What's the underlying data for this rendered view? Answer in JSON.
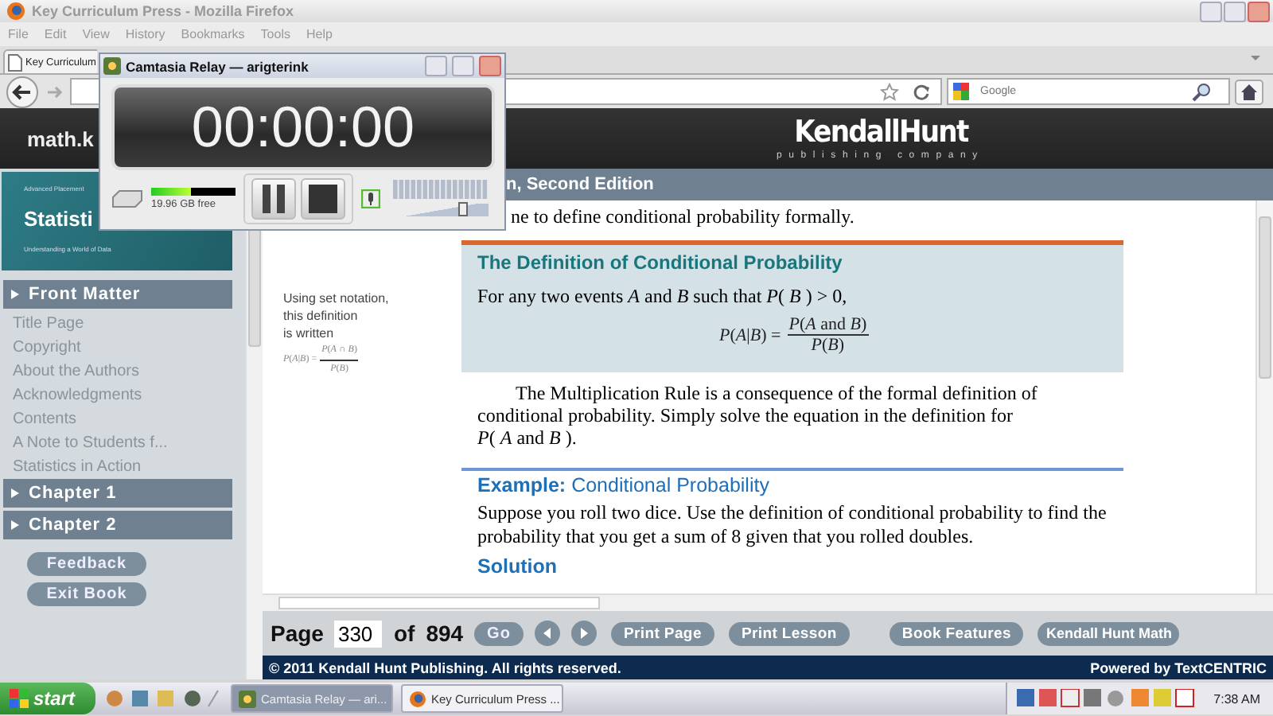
{
  "browser": {
    "title": "Key Curriculum Press - Mozilla Firefox",
    "menu": [
      "File",
      "Edit",
      "View",
      "History",
      "Bookmarks",
      "Tools",
      "Help"
    ],
    "tab": "Key Curriculum",
    "search": {
      "placeholder": "Google"
    }
  },
  "recorder": {
    "title": "Camtasia Relay — arigterink",
    "timer": "00:00:00",
    "disk": {
      "level": 0.47,
      "label": "19.96 GB free"
    },
    "volume": {
      "level": 0.73
    }
  },
  "site": {
    "host": "math.k",
    "logo": "KendallHunt",
    "logo_sub": "publishing company"
  },
  "sidebar": {
    "cover": {
      "kicker": "Advanced Placement",
      "title": "Statisti",
      "subtitle": "Understanding a World of Data"
    },
    "sections": [
      {
        "label": "Front Matter",
        "children": [
          "Title Page",
          "Copyright",
          "About the Authors",
          "Acknowledgments",
          "Contents",
          "A Note to Students f...",
          "Statistics in Action"
        ]
      },
      {
        "label": "Chapter 1"
      },
      {
        "label": "Chapter 2"
      }
    ],
    "buttons": [
      "Feedback",
      "Exit Book"
    ]
  },
  "section_title": "n, Second Edition",
  "content": {
    "intro": "ne to define conditional probability formally.",
    "margin_note": [
      "Using set notation,",
      "this definition",
      "is written"
    ],
    "margin_formula": {
      "left": "*P*(*A*|*B*) =",
      "num": "*P*(*A* ∩ *B*)",
      "den": "*P*(*B*)"
    },
    "definition": {
      "title": "The Definition of Conditional Probability",
      "statement": "For any two events *A* and *B* such that *P*( *B* ) > 0,",
      "formula": {
        "left": "*P*(*A*|*B*) =",
        "num": "*P*(*A* and *B*)",
        "den": "*P*(*B*)"
      }
    },
    "paragraph": "The Multiplication Rule is a consequence of the formal definition of conditional probability. Simply solve the equation in the definition for *P*( *A* and *B* ).",
    "example": {
      "label": "Example:",
      "title": "Conditional Probability",
      "text": "Suppose you roll two dice. Use the definition of conditional probability to find the probability that you get a sum of 8 given that you rolled doubles."
    },
    "solution": "Solution"
  },
  "toolbar": {
    "page_label": "Page",
    "page": "330",
    "of": "of",
    "total": "894",
    "go": "Go",
    "buttons": [
      "Print Page",
      "Print Lesson",
      "Book Features",
      "Kendall Hunt Math"
    ]
  },
  "footer": {
    "copyright": "© 2011 Kendall Hunt Publishing. All rights reserved.",
    "powered": "Powered by TextCENTRIC"
  },
  "taskbar": {
    "start": "start",
    "tasks": [
      {
        "label": "Camtasia Relay — ari...",
        "selected": true
      },
      {
        "label": "Key Curriculum Press ...",
        "selected": false
      }
    ],
    "time": "7:38 AM"
  }
}
